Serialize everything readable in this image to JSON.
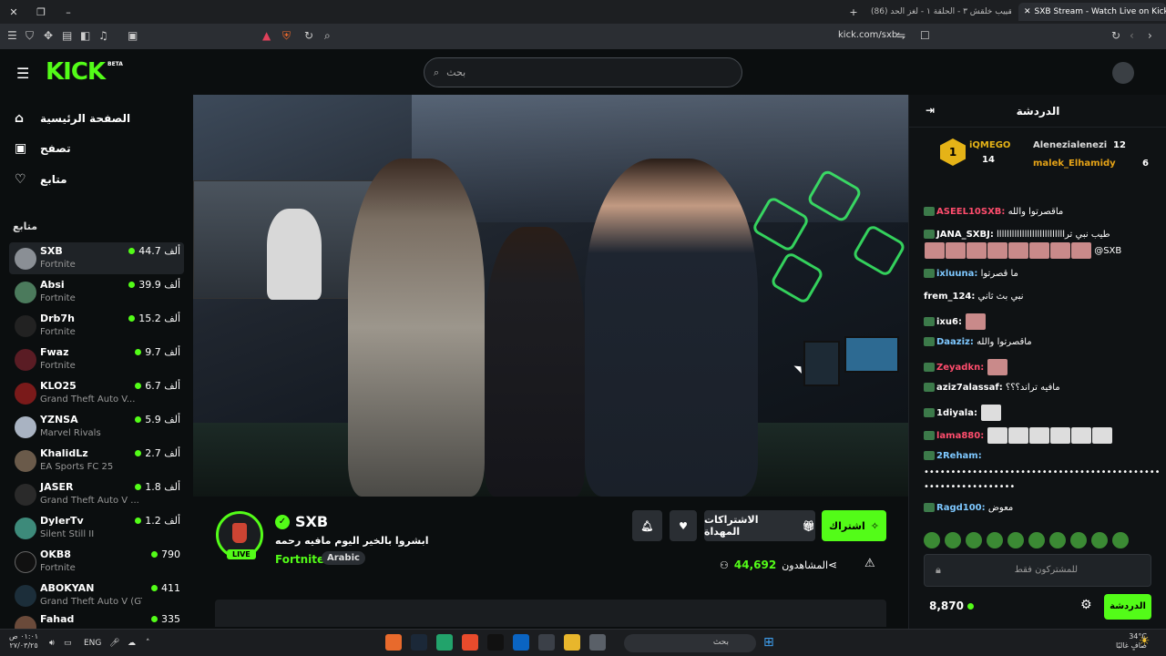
{
  "browser": {
    "tabs": [
      {
        "label": "(86) التقييب خلقش ٣ - الحلقة ١ - لغز الحد..."
      },
      {
        "label": "SXB Stream - Watch Live on Kick"
      }
    ],
    "url": "kick.com/sxb"
  },
  "header": {
    "logo": "KICK",
    "beta": "BETA",
    "search_placeholder": "بحث"
  },
  "sidebar": {
    "nav": [
      {
        "label": "الصفحة الرئيسية",
        "icon": "home-icon"
      },
      {
        "label": "تصفح",
        "icon": "browse-icon"
      },
      {
        "label": "متابع",
        "icon": "heart-icon"
      }
    ],
    "section_title": "متابع",
    "channels": [
      {
        "name": "SXB",
        "game": "Fortnite",
        "viewers": "44.7 ألف"
      },
      {
        "name": "Absi",
        "game": "Fortnite",
        "viewers": "39.9 ألف"
      },
      {
        "name": "Drb7h",
        "game": "Fortnite",
        "viewers": "15.2 ألف"
      },
      {
        "name": "Fwaz",
        "game": "Fortnite",
        "viewers": "9.7 ألف"
      },
      {
        "name": "KLO25",
        "game": "Grand Theft Auto V...",
        "viewers": "6.7 ألف"
      },
      {
        "name": "YZNSA",
        "game": "Marvel Rivals",
        "viewers": "5.9 ألف"
      },
      {
        "name": "KhalidLz",
        "game": "EA Sports FC 25",
        "viewers": "2.7 ألف"
      },
      {
        "name": "JASER",
        "game": "Grand Theft Auto V ...",
        "viewers": "1.8 ألف"
      },
      {
        "name": "DylerTv",
        "game": "Silent Still II",
        "viewers": "1.2 ألف"
      },
      {
        "name": "OKB8",
        "game": "Fortnite",
        "viewers": "790"
      },
      {
        "name": "ABOKYAN",
        "game": "Grand Theft Auto V (GT...",
        "viewers": "411"
      },
      {
        "name": "Fahad",
        "game": "",
        "viewers": "335"
      }
    ]
  },
  "stream": {
    "live_badge": "LIVE",
    "streamer": "SXB",
    "title": "ابشروا بالخير اليوم مافيه رحمه",
    "game": "Fortnite",
    "language": "Arabic",
    "subscribe_label": "اشتراك",
    "gift_label": "الاشتراكات المهداة",
    "viewers_label": "المشاهدون",
    "viewers_count": "44,692"
  },
  "chat": {
    "title": "الدردشة",
    "top_gifters": [
      {
        "name": "iQMEGO",
        "count": "14",
        "rank": "1"
      },
      {
        "name": "Alenezialenezi",
        "count": "12"
      },
      {
        "name": "malek_Elhamidy",
        "count": "6"
      }
    ],
    "messages": [
      {
        "user": "ASEEL10SXB:",
        "text": "ماقصرتوا والله",
        "color": "#ff4d6d"
      },
      {
        "user": "JANA_SXBJ:",
        "text": "طيب نبي ترااااااااااااااااااااااااااا",
        "color": "#ffffff"
      },
      {
        "user": "",
        "text": "@SXB",
        "color": "#ffffff"
      },
      {
        "user": "ixluuna:",
        "text": "ما قصرتوا",
        "color": "#7ec8ff"
      },
      {
        "user": "frem_124:",
        "text": "نبي بث ثاني",
        "color": "#ffffff"
      },
      {
        "user": "ixu6:",
        "text": "",
        "color": "#ffffff"
      },
      {
        "user": "Daaziz:",
        "text": "ماقصرتوا والله",
        "color": "#7ec8ff"
      },
      {
        "user": "Zeyadkn:",
        "text": "",
        "color": "#ff4d6d"
      },
      {
        "user": "aziz7alassaf:",
        "text": "مافيه تراند؟؟؟",
        "color": "#ffffff"
      },
      {
        "user": "1diyala:",
        "text": "",
        "color": "#ffffff"
      },
      {
        "user": "lama880:",
        "text": "",
        "color": "#ff4d6d"
      },
      {
        "user": "2Reham:",
        "text": "",
        "color": "#7ec8ff"
      },
      {
        "user": "",
        "text": "•••••••••••••••••••••••••••••••••••••••••••••",
        "color": "#ffffff"
      },
      {
        "user": "",
        "text": "•••••••••••••••••",
        "color": "#ffffff"
      },
      {
        "user": "Ragd100:",
        "text": "معوض",
        "color": "#7ec8ff"
      }
    ],
    "input_placeholder": "للمشتركون فقط",
    "points": "8,870",
    "send_label": "الدردشة"
  },
  "taskbar": {
    "time": "٠١:٠١ ص",
    "date": "٢٧/٠٣/٢٥",
    "lang": "ENG",
    "search": "بحث",
    "temp": "34°C",
    "weather": "صافٍ غالبًا"
  }
}
